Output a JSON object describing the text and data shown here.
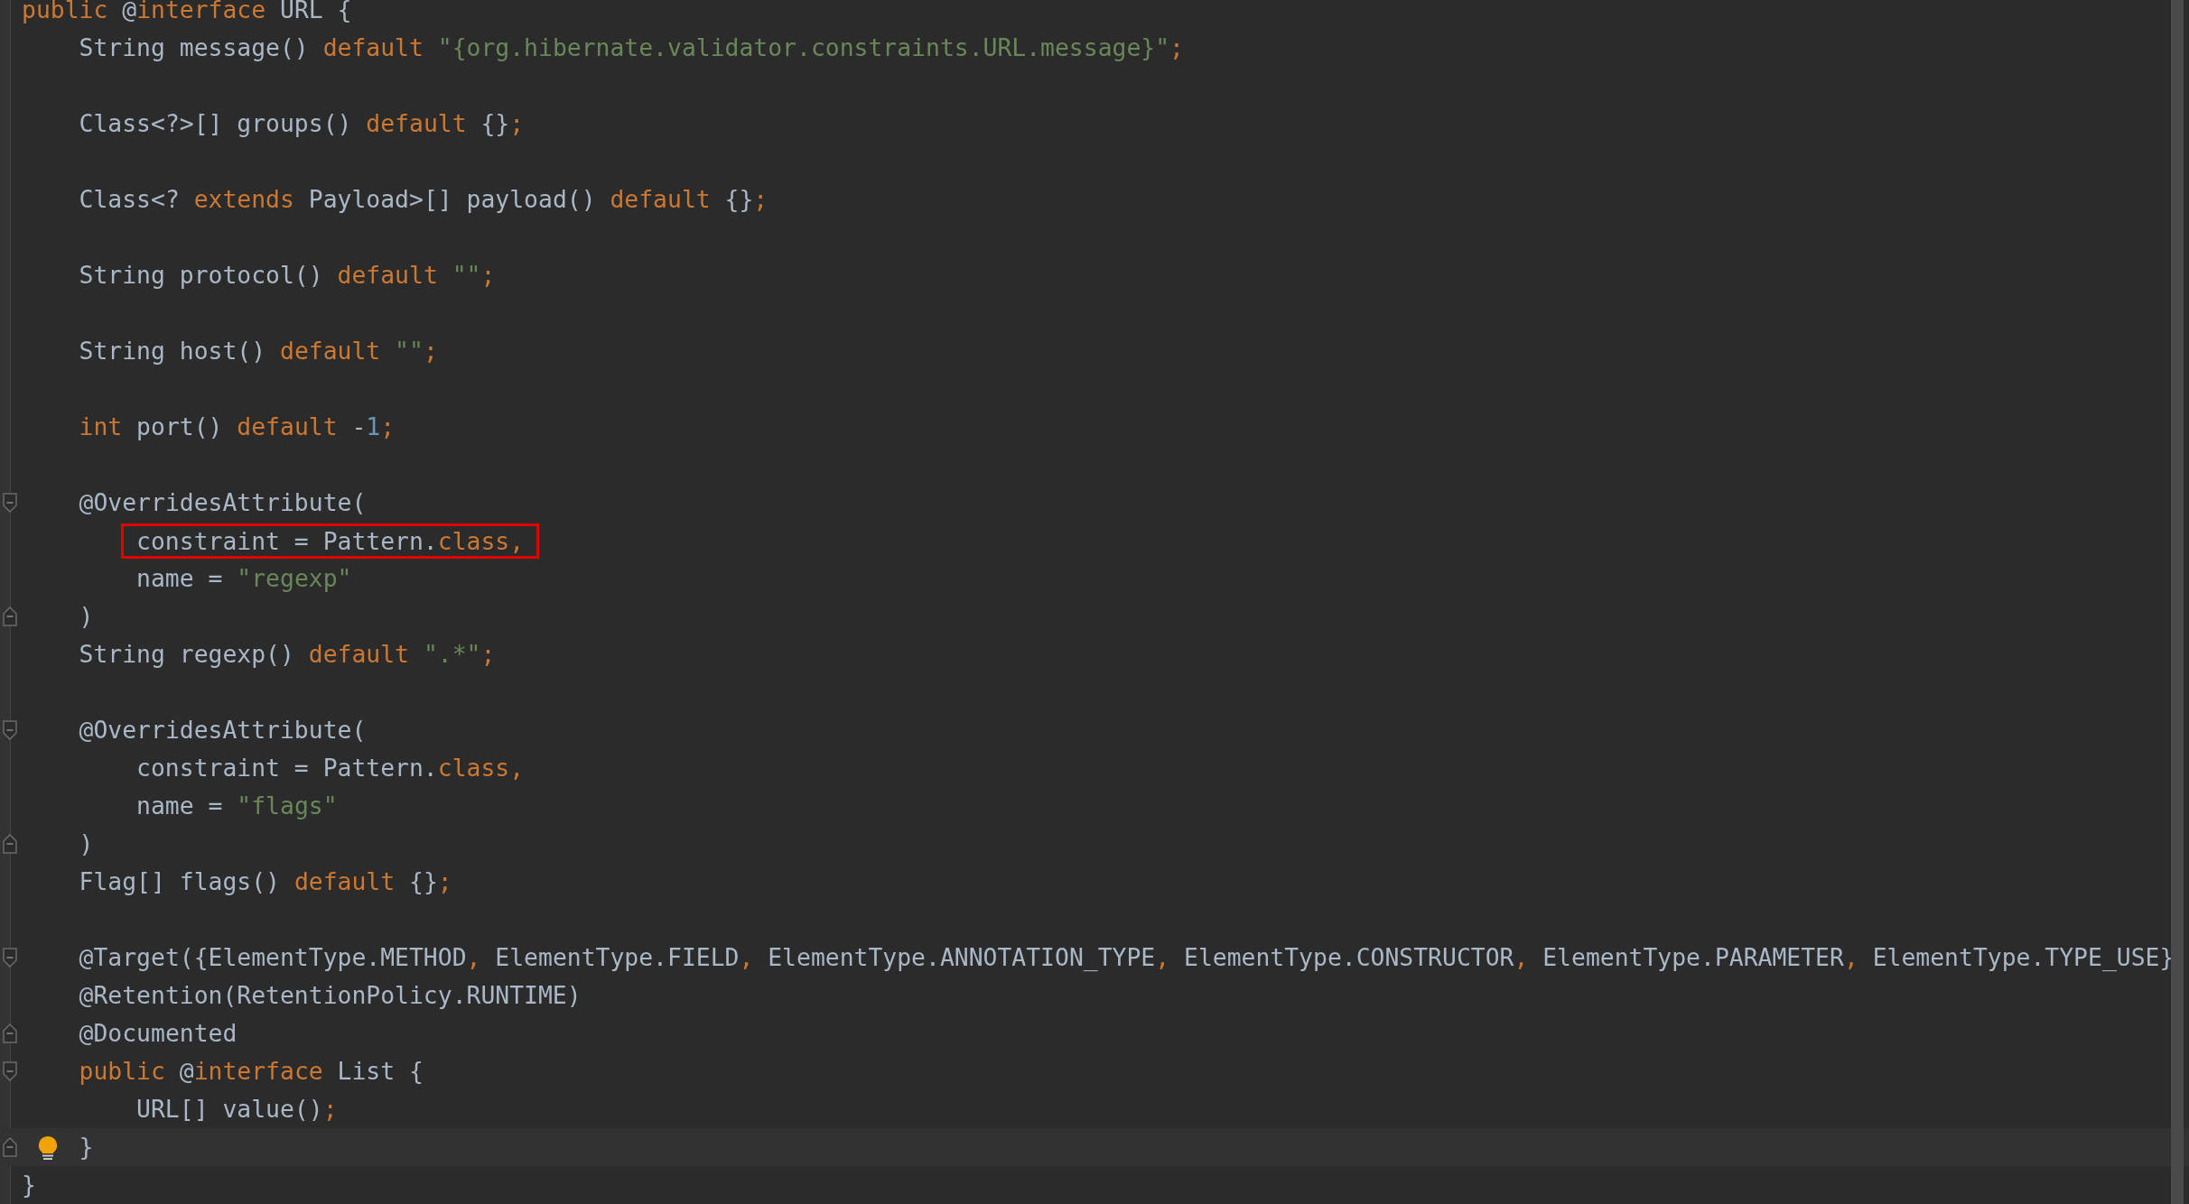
{
  "editor": {
    "lines": [
      {
        "kind": "code",
        "tokens": [
          {
            "kind": "keyword",
            "text": "public"
          },
          {
            "kind": "plain",
            "text": " @"
          },
          {
            "kind": "keyword",
            "text": "interface"
          },
          {
            "kind": "plain",
            "text": " URL {"
          }
        ],
        "children": [
          {
            "kind": "code",
            "tokens": [
              {
                "kind": "plain",
                "text": "String message() "
              },
              {
                "kind": "keyword",
                "text": "default"
              },
              {
                "kind": "string",
                "text": " \"{org.hibernate.validator.constraints.URL.message}\""
              },
              {
                "kind": "keyword",
                "text": ";"
              }
            ]
          },
          {
            "kind": "blank"
          },
          {
            "kind": "code",
            "tokens": [
              {
                "kind": "plain",
                "text": "Class<?>[] groups() "
              },
              {
                "kind": "keyword",
                "text": "default"
              },
              {
                "kind": "plain",
                "text": " {}"
              },
              {
                "kind": "keyword",
                "text": ";"
              }
            ]
          },
          {
            "kind": "blank"
          },
          {
            "kind": "code",
            "tokens": [
              {
                "kind": "plain",
                "text": "Class<? "
              },
              {
                "kind": "keyword",
                "text": "extends"
              },
              {
                "kind": "plain",
                "text": " Payload>[] payload() "
              },
              {
                "kind": "keyword",
                "text": "default"
              },
              {
                "kind": "plain",
                "text": " {}"
              },
              {
                "kind": "keyword",
                "text": ";"
              }
            ]
          },
          {
            "kind": "blank"
          },
          {
            "kind": "code",
            "tokens": [
              {
                "kind": "plain",
                "text": "String protocol() "
              },
              {
                "kind": "keyword",
                "text": "default"
              },
              {
                "kind": "string",
                "text": " \"\""
              },
              {
                "kind": "keyword",
                "text": ";"
              }
            ]
          },
          {
            "kind": "blank"
          },
          {
            "kind": "code",
            "tokens": [
              {
                "kind": "plain",
                "text": "String host() "
              },
              {
                "kind": "keyword",
                "text": "default"
              },
              {
                "kind": "string",
                "text": " \"\""
              },
              {
                "kind": "keyword",
                "text": ";"
              }
            ]
          },
          {
            "kind": "blank"
          },
          {
            "kind": "code",
            "tokens": [
              {
                "kind": "keyword",
                "text": "int"
              },
              {
                "kind": "plain",
                "text": " port() "
              },
              {
                "kind": "keyword",
                "text": "default"
              },
              {
                "kind": "plain",
                "text": " -"
              },
              {
                "kind": "number",
                "text": "1"
              },
              {
                "kind": "keyword",
                "text": ";"
              }
            ]
          },
          {
            "kind": "blank"
          },
          {
            "kind": "code",
            "fold_start": true,
            "tokens": [
              {
                "kind": "plain",
                "text": "@OverridesAttribute("
              }
            ],
            "children": [
              {
                "kind": "code",
                "boxed": true,
                "tokens": [
                  {
                    "kind": "plain",
                    "text": "constraint = Pattern."
                  },
                  {
                    "kind": "keyword",
                    "text": "class"
                  },
                  {
                    "kind": "keyword",
                    "text": ","
                  }
                ]
              },
              {
                "kind": "code",
                "tokens": [
                  {
                    "kind": "plain",
                    "text": "name = "
                  },
                  {
                    "kind": "string",
                    "text": "\"regexp\""
                  }
                ]
              }
            ]
          },
          {
            "kind": "code",
            "fold_end": true,
            "tokens": [
              {
                "kind": "plain",
                "text": ")"
              }
            ]
          },
          {
            "kind": "code",
            "tokens": [
              {
                "kind": "plain",
                "text": "String regexp() "
              },
              {
                "kind": "keyword",
                "text": "default"
              },
              {
                "kind": "string",
                "text": " \".*\""
              },
              {
                "kind": "keyword",
                "text": ";"
              }
            ]
          },
          {
            "kind": "blank"
          },
          {
            "kind": "code",
            "fold_start": true,
            "tokens": [
              {
                "kind": "plain",
                "text": "@OverridesAttribute("
              }
            ],
            "children": [
              {
                "kind": "code",
                "tokens": [
                  {
                    "kind": "plain",
                    "text": "constraint = Pattern."
                  },
                  {
                    "kind": "keyword",
                    "text": "class"
                  },
                  {
                    "kind": "keyword",
                    "text": ","
                  }
                ]
              },
              {
                "kind": "code",
                "tokens": [
                  {
                    "kind": "plain",
                    "text": "name = "
                  },
                  {
                    "kind": "string",
                    "text": "\"flags\""
                  }
                ]
              }
            ]
          },
          {
            "kind": "code",
            "fold_end": true,
            "tokens": [
              {
                "kind": "plain",
                "text": ")"
              }
            ]
          },
          {
            "kind": "code",
            "tokens": [
              {
                "kind": "plain",
                "text": "Flag[] flags() "
              },
              {
                "kind": "keyword",
                "text": "default"
              },
              {
                "kind": "plain",
                "text": " {}"
              },
              {
                "kind": "keyword",
                "text": ";"
              }
            ]
          },
          {
            "kind": "blank"
          },
          {
            "kind": "code",
            "fold_start": true,
            "tokens": [
              {
                "kind": "plain",
                "text": "@Target({ElementType.METHOD"
              },
              {
                "kind": "keyword",
                "text": ","
              },
              {
                "kind": "plain",
                "text": " ElementType.FIELD"
              },
              {
                "kind": "keyword",
                "text": ","
              },
              {
                "kind": "plain",
                "text": " ElementType.ANNOTATION_TYPE"
              },
              {
                "kind": "keyword",
                "text": ","
              },
              {
                "kind": "plain",
                "text": " ElementType.CONSTRUCTOR"
              },
              {
                "kind": "keyword",
                "text": ","
              },
              {
                "kind": "plain",
                "text": " ElementType.PARAMETER"
              },
              {
                "kind": "keyword",
                "text": ","
              },
              {
                "kind": "plain",
                "text": " ElementType.TYPE_USE}"
              }
            ]
          },
          {
            "kind": "code",
            "tokens": [
              {
                "kind": "plain",
                "text": "@Retention(RetentionPolicy.RUNTIME)"
              }
            ]
          },
          {
            "kind": "code",
            "fold_end": true,
            "tokens": [
              {
                "kind": "plain",
                "text": "@Documented"
              }
            ]
          },
          {
            "kind": "code",
            "fold_start": true,
            "tokens": [
              {
                "kind": "keyword",
                "text": "public"
              },
              {
                "kind": "plain",
                "text": " @"
              },
              {
                "kind": "keyword",
                "text": "interface"
              },
              {
                "kind": "plain",
                "text": " List {"
              }
            ],
            "children": [
              {
                "kind": "code",
                "tokens": [
                  {
                    "kind": "plain",
                    "text": "URL[] value()"
                  },
                  {
                    "kind": "keyword",
                    "text": ";"
                  }
                ]
              }
            ]
          },
          {
            "kind": "code",
            "fold_end": true,
            "current": true,
            "bulb": true,
            "tokens": [
              {
                "kind": "plain",
                "text": "}"
              }
            ]
          }
        ]
      },
      {
        "kind": "code",
        "tokens": [
          {
            "kind": "plain",
            "text": "}"
          }
        ]
      }
    ]
  }
}
